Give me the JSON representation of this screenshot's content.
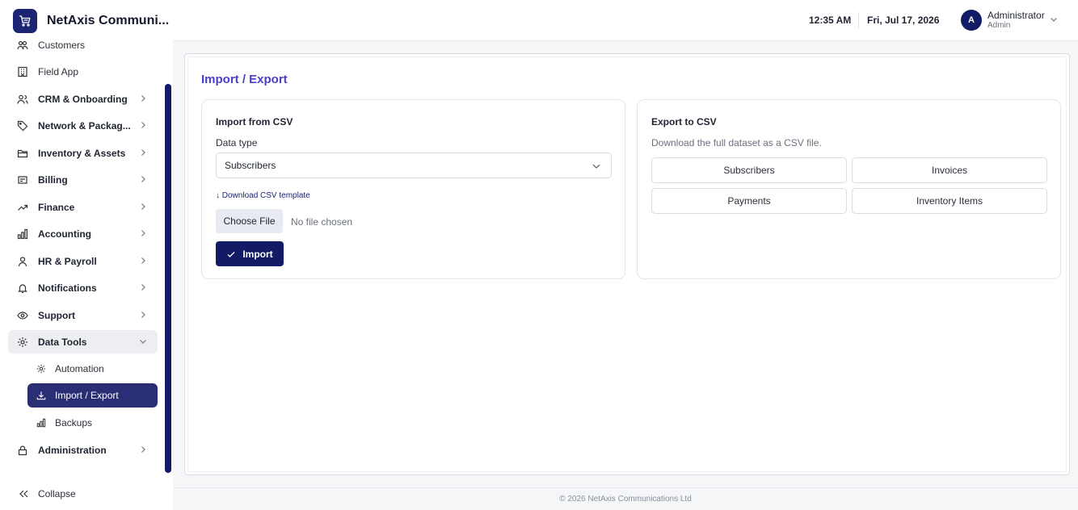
{
  "app": {
    "name": "NetAxis Communi..."
  },
  "sidebar": {
    "items": [
      {
        "label": "Customers"
      },
      {
        "label": "Field App"
      },
      {
        "label": "CRM & Onboarding"
      },
      {
        "label": "Network & Packag..."
      },
      {
        "label": "Inventory & Assets"
      },
      {
        "label": "Billing"
      },
      {
        "label": "Finance"
      },
      {
        "label": "Accounting"
      },
      {
        "label": "HR & Payroll"
      },
      {
        "label": "Notifications"
      },
      {
        "label": "Support"
      },
      {
        "label": "Data Tools"
      },
      {
        "label": "Administration"
      }
    ],
    "subitems": [
      {
        "label": "Automation"
      },
      {
        "label": "Import / Export"
      },
      {
        "label": "Backups"
      }
    ],
    "collapse_label": "Collapse"
  },
  "header": {
    "time": "12:35 AM",
    "date": "Fri, Jul 17, 2026",
    "user": {
      "initial": "A",
      "name": "Administrator",
      "role": "Admin"
    }
  },
  "main": {
    "title": "Import / Export",
    "import": {
      "title": "Import from CSV",
      "data_type_label": "Data type",
      "data_type_value": "Subscribers",
      "download_link": "↓ Download CSV template",
      "choose_file_label": "Choose File",
      "file_status": "No file chosen",
      "import_label": "Import"
    },
    "export": {
      "title": "Export to CSV",
      "description": "Download the full dataset as a CSV file.",
      "buttons": [
        {
          "label": "Subscribers"
        },
        {
          "label": "Invoices"
        },
        {
          "label": "Payments"
        },
        {
          "label": "Inventory Items"
        }
      ]
    }
  },
  "footer": {
    "text": "© 2026 NetAxis Communications Ltd"
  },
  "colors": {
    "brand": "#131a66",
    "accent": "#4a3fc9",
    "active_nav": "#2a2e74"
  }
}
